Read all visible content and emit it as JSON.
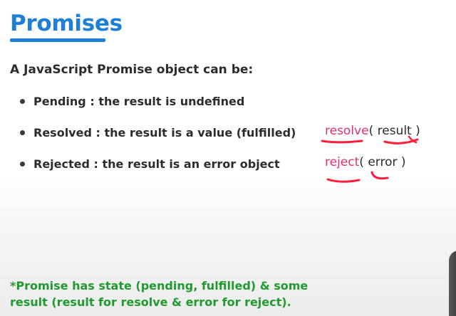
{
  "slide": {
    "title": "Promises",
    "intro": "A JavaScript Promise object can be:",
    "bullets": [
      {
        "state": "Pending",
        "sep": " : ",
        "desc": "the result is undefined"
      },
      {
        "state": "Resolved",
        "sep": " : ",
        "desc": "the result is a value (fulfilled)"
      },
      {
        "state": "Rejected",
        "sep": " : ",
        "desc": "the result is an error object"
      }
    ],
    "code": {
      "resolve_kw": "resolve",
      "resolve_rest": "( result )",
      "reject_kw": "reject",
      "reject_rest": "( error  )"
    },
    "note_line1": "*Promise has state (pending, fulfilled) & some",
    "note_line2": "result (result for resolve & error for reject)."
  },
  "colors": {
    "title": "#1e7fd6",
    "underline": "#1e7fd6",
    "text": "#2c2c2c",
    "bullet": "#3a3a3a",
    "keyword": "#e0306b",
    "ink": "#ff1e3c",
    "note": "#1e9a2f"
  }
}
